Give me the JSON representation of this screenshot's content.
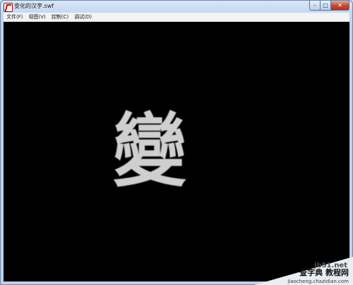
{
  "window": {
    "title": "变化的汉字.swf",
    "controls": {
      "minimize": "–",
      "maximize": "□",
      "close": "✕"
    }
  },
  "menubar": {
    "items": [
      {
        "label": "文件(F)"
      },
      {
        "label": "视图(V)"
      },
      {
        "label": "控制(C)"
      },
      {
        "label": "调试(D)"
      }
    ]
  },
  "content": {
    "character": "變",
    "background": "#000000",
    "character_color": "#cfcfcf"
  },
  "watermark": {
    "site": "jb51.net",
    "brand": "查字典 教程网",
    "url": "jiaocheng.chazidian.com"
  }
}
